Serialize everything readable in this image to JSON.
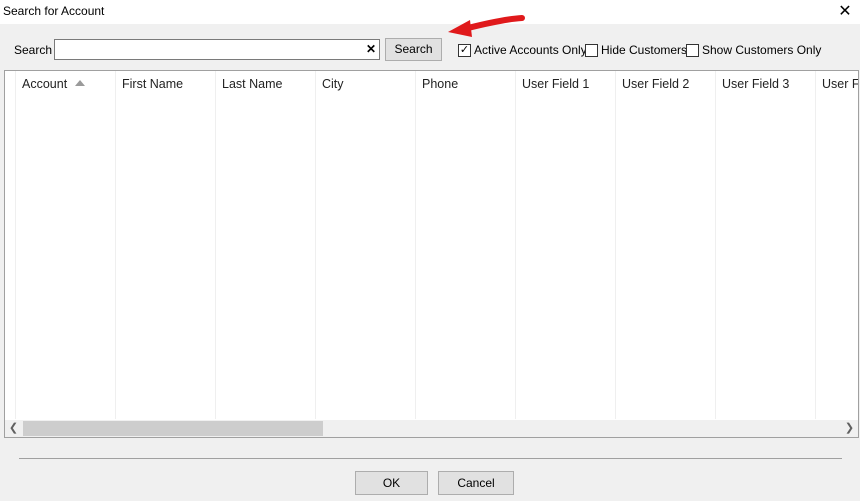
{
  "window": {
    "title": "Search for Account"
  },
  "search": {
    "label": "Search",
    "value": "",
    "placeholder": "",
    "button_label": "Search"
  },
  "filters": [
    {
      "label": "Active Accounts Only",
      "checked": true
    },
    {
      "label": "Hide Customers",
      "checked": false
    },
    {
      "label": "Show Customers Only",
      "checked": false
    }
  ],
  "grid": {
    "columns": [
      "Account",
      "First Name",
      "Last Name",
      "City",
      "Phone",
      "User Field 1",
      "User Field 2",
      "User Field 3",
      "User F"
    ],
    "sorted_column": "Account",
    "sort_direction": "ascending",
    "rows": []
  },
  "footer": {
    "ok_label": "OK",
    "cancel_label": "Cancel"
  },
  "icons": {
    "clear": "close-icon",
    "arrow": "red-arrow-icon"
  },
  "colors": {
    "arrow": "#e0191b",
    "scroll_thumb": "#cdcdcd"
  }
}
